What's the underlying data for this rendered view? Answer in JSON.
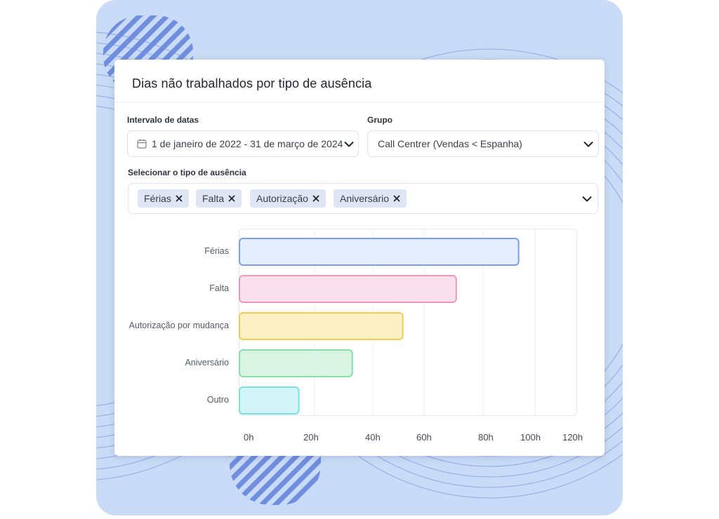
{
  "card": {
    "title": "Dias não trabalhados por tipo de ausência"
  },
  "filters": {
    "date_range": {
      "label": "Intervalo de datas",
      "value": "1 de janeiro de 2022 - 31 de março de 2024"
    },
    "group": {
      "label": "Grupo",
      "value": "Call Centrer (Vendas < Espanha)"
    },
    "absence_type": {
      "label": "Selecionar o tipo de ausência",
      "chips": [
        "Férias",
        "Falta",
        "Autorização",
        "Aniversário"
      ]
    }
  },
  "icons": {
    "date": "calendar-icon",
    "dropdown": "chevron-down-icon",
    "chip_remove": "close-icon"
  },
  "chart_data": {
    "type": "bar",
    "orientation": "horizontal",
    "categories": [
      "Férias",
      "Falta",
      "Autorização por mudança",
      "Aniversário",
      "Outro"
    ],
    "values": [
      94,
      73,
      55,
      38,
      20
    ],
    "x_ticks": [
      "0h",
      "20h",
      "40h",
      "60h",
      "80h",
      "100h",
      "120h"
    ],
    "xlim": [
      0,
      120
    ],
    "grid": true,
    "fills": [
      "#e3edfb",
      "#f8e1ec",
      "#fbf0c6",
      "#d9f4e3",
      "#d2f4f6"
    ],
    "strokes": [
      "#7d9ee0",
      "#e79ab7",
      "#f3cb52",
      "#86dea9",
      "#78e0e4"
    ]
  }
}
